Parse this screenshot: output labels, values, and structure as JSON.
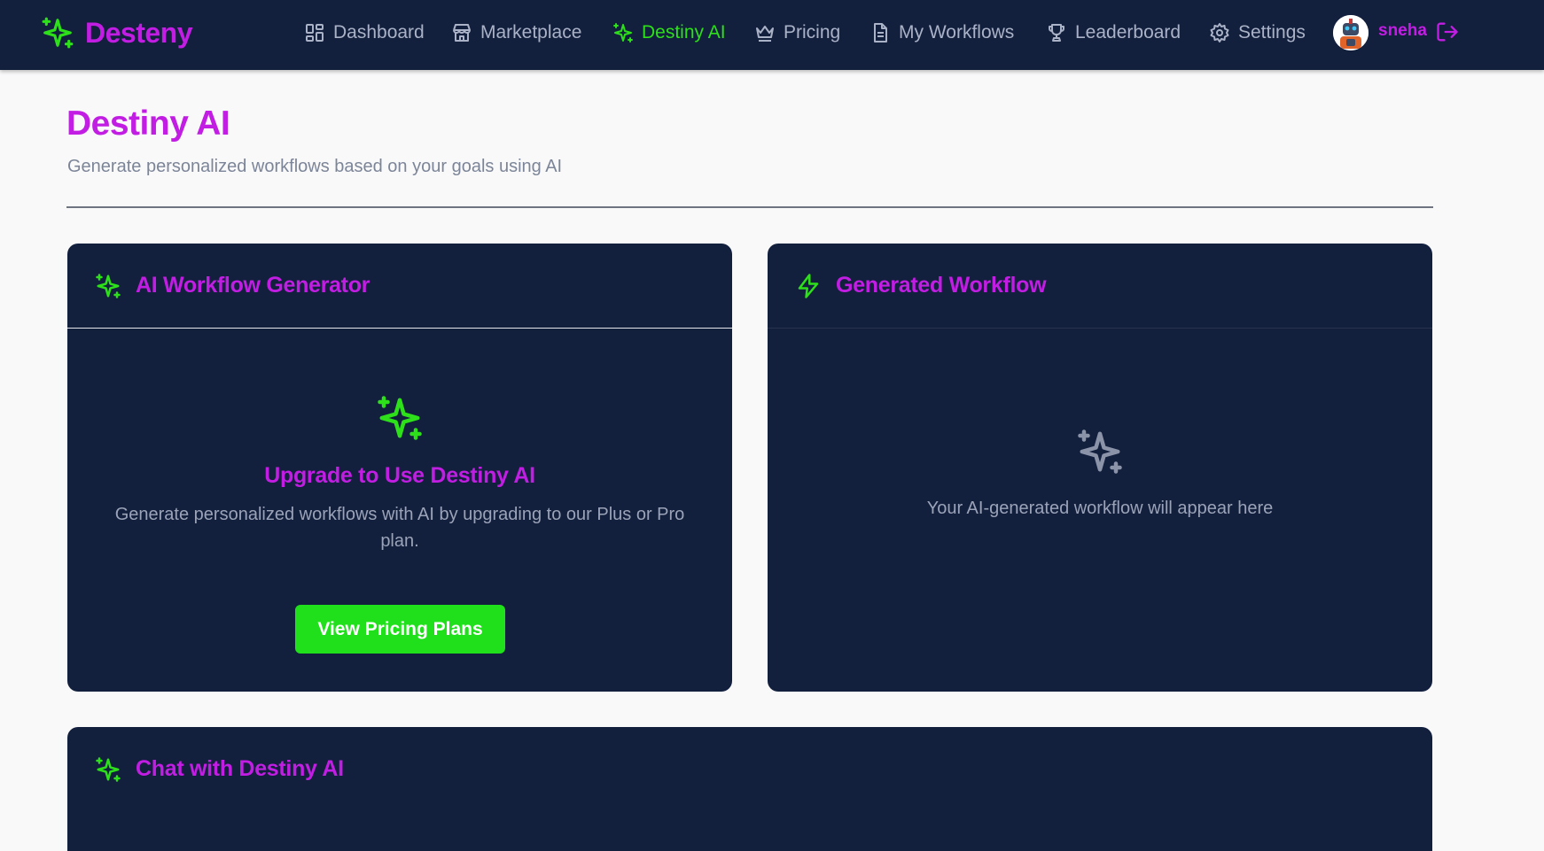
{
  "brand": {
    "name": "Desteny"
  },
  "nav": {
    "items": [
      {
        "label": "Dashboard"
      },
      {
        "label": "Marketplace"
      },
      {
        "label": "Destiny AI"
      },
      {
        "label": "Pricing"
      },
      {
        "label": "My Workflows"
      },
      {
        "label": "Leaderboard"
      },
      {
        "label": "Settings"
      }
    ],
    "active": "Destiny AI"
  },
  "user": {
    "name": "sneha"
  },
  "page": {
    "title": "Destiny AI",
    "subtitle": "Generate personalized workflows based on your goals using AI"
  },
  "generator": {
    "title": "AI Workflow Generator",
    "upgrade_title": "Upgrade to Use Destiny AI",
    "upgrade_desc": "Generate personalized workflows with AI by upgrading to our Plus or Pro plan.",
    "cta_label": "View Pricing Plans"
  },
  "generated": {
    "title": "Generated Workflow",
    "placeholder": "Your AI-generated workflow will appear here"
  },
  "chat": {
    "title": "Chat with Destiny AI"
  },
  "colors": {
    "nav_bg": "#121f3d",
    "card_bg": "#121f3d",
    "accent_magenta": "#c21ee3",
    "accent_green": "#2de01a",
    "muted_text": "#9ba3b8",
    "page_bg": "#f9f9fa"
  },
  "icons": {
    "brand": "sparkles-icon",
    "dashboard": "grid-icon",
    "marketplace": "store-icon",
    "destiny_ai": "sparkles-icon",
    "pricing": "crown-icon",
    "my_workflows": "document-icon",
    "leaderboard": "trophy-icon",
    "settings": "gear-icon",
    "logout": "logout-icon",
    "generated": "lightning-icon"
  }
}
